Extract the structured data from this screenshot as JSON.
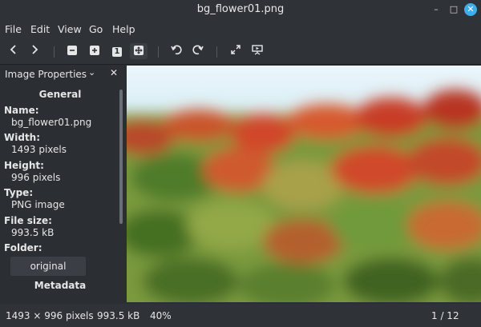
{
  "window": {
    "title": "bg_flower01.png"
  },
  "window_controls": {
    "minimize": "–",
    "maximize": "□",
    "close": "✕"
  },
  "menu": [
    "File",
    "Edit",
    "View",
    "Go",
    "Help"
  ],
  "toolbar": {
    "icons": [
      "previous-icon",
      "next-icon",
      "zoom-out-icon",
      "zoom-in-icon",
      "original-size-icon",
      "fit-window-icon",
      "rotate-left-icon",
      "rotate-right-icon",
      "fullscreen-icon",
      "slideshow-icon"
    ],
    "original_size_glyph": "1"
  },
  "panel": {
    "title": "Image Properties",
    "dropdown_glyph": "⌄",
    "close_glyph": "✕",
    "general_heading": "General",
    "props": [
      {
        "label": "Name:",
        "value": "bg_flower01.png"
      },
      {
        "label": "Width:",
        "value": "1493 pixels"
      },
      {
        "label": "Height:",
        "value": "996 pixels"
      },
      {
        "label": "Type:",
        "value": "PNG image"
      },
      {
        "label": "File size:",
        "value": "993.5 kB"
      }
    ],
    "folder_label": "Folder:",
    "folder_button": "original",
    "metadata_heading": "Metadata"
  },
  "status": {
    "dimensions": "1493 × 996 pixels",
    "size": "993.5 kB",
    "zoom": "40%",
    "position": "1 / 12"
  }
}
